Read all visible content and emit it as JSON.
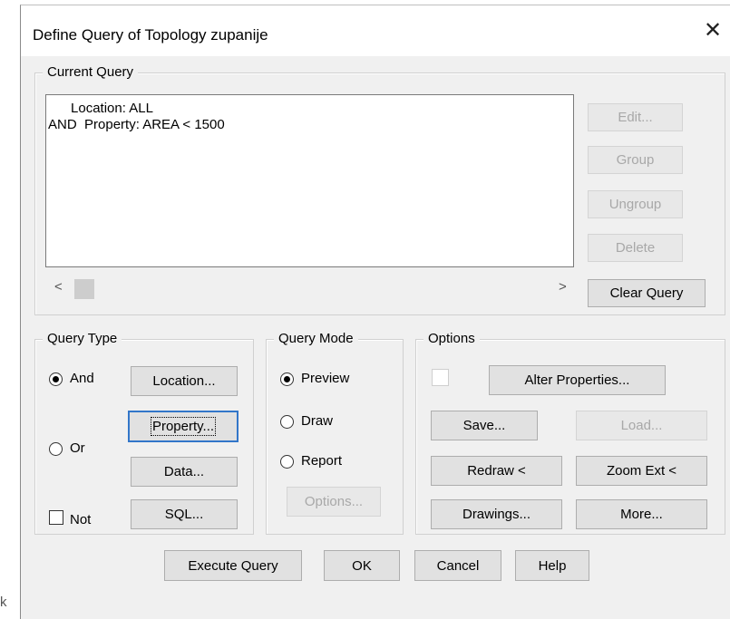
{
  "stray_text": "k",
  "dialog": {
    "title": "Define Query of Topology zupanije",
    "close_glyph": "✕"
  },
  "current_query": {
    "group_label": "Current Query",
    "lines": [
      "      Location: ALL",
      "AND  Property: AREA < 1500"
    ],
    "scroll_left": "<",
    "scroll_right": ">",
    "buttons": {
      "edit": "Edit...",
      "group": "Group",
      "ungroup": "Ungroup",
      "delete": "Delete",
      "clear_query": "Clear Query"
    }
  },
  "query_type": {
    "group_label": "Query Type",
    "and_label": "And",
    "or_label": "Or",
    "not_label": "Not",
    "selected": "And",
    "not_checked": false,
    "buttons": {
      "location": "Location...",
      "property": "Property...",
      "data": "Data...",
      "sql": "SQL..."
    }
  },
  "query_mode": {
    "group_label": "Query Mode",
    "preview_label": "Preview",
    "draw_label": "Draw",
    "report_label": "Report",
    "selected": "Preview",
    "options_button": "Options..."
  },
  "options": {
    "group_label": "Options",
    "alter_properties": "Alter Properties...",
    "save": "Save...",
    "load": "Load...",
    "redraw": "Redraw <",
    "zoom_ext": "Zoom Ext <",
    "drawings": "Drawings...",
    "more": "More..."
  },
  "footer": {
    "execute_query": "Execute Query",
    "ok": "OK",
    "cancel": "Cancel",
    "help": "Help"
  }
}
